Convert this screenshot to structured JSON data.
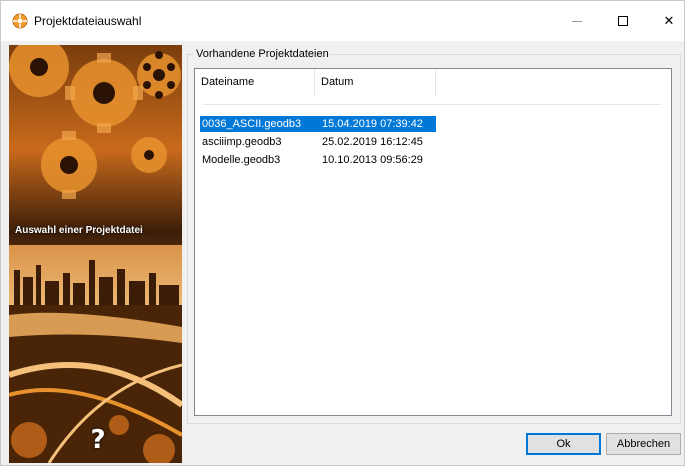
{
  "window": {
    "title": "Projektdateiauswahl",
    "controls": {
      "minimize": "minimize",
      "maximize": "maximize",
      "close": "✕"
    }
  },
  "banner": {
    "label": "Auswahl einer Projektdatei",
    "help_glyph": "?"
  },
  "group": {
    "title": "Vorhandene Projektdateien"
  },
  "list": {
    "columns": [
      "Dateiname",
      "Datum"
    ],
    "rows": [
      {
        "name": "0036_ASCII.geodb3",
        "date": "15.04.2019 07:39:42",
        "selected": true
      },
      {
        "name": "asciiimp.geodb3",
        "date": "25.02.2019 16:12:45",
        "selected": false
      },
      {
        "name": "Modelle.geodb3",
        "date": "10.10.2013 09:56:29",
        "selected": false
      }
    ]
  },
  "buttons": {
    "ok": "Ok",
    "cancel": "Abbrechen"
  },
  "colors": {
    "selection": "#0078d7",
    "banner_orange": "#e8922e"
  }
}
